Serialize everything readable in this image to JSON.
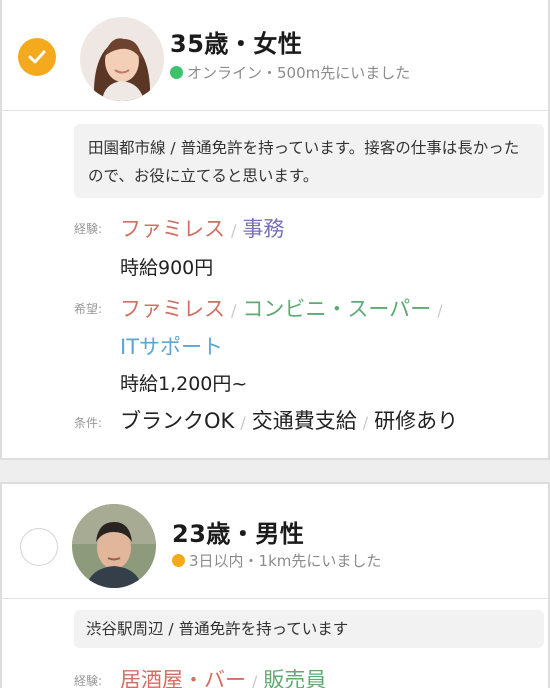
{
  "candidates": [
    {
      "selected": true,
      "name": "35歳・女性",
      "status_color": "#3cc26b",
      "status_text": "オンライン・500m先にいました",
      "bio": "田園都市線 / 普通免許を持っています。接客の仕事は長かったので、お役に立てると思います。",
      "experience": {
        "label": "経験:",
        "items": [
          {
            "text": "ファミレス",
            "color": "red"
          },
          {
            "text": "事務",
            "color": "purple"
          }
        ],
        "wage": "時給900円"
      },
      "desired": {
        "label": "希望:",
        "items": [
          {
            "text": "ファミレス",
            "color": "red"
          },
          {
            "text": "コンビニ・スーパー",
            "color": "green"
          },
          {
            "text": "ITサポート",
            "color": "blue"
          }
        ],
        "wage": "時給1,200円~"
      },
      "conditions": {
        "label": "条件:",
        "items": [
          "ブランクOK",
          "交通費支給",
          "研修あり"
        ]
      }
    },
    {
      "selected": false,
      "name": "23歳・男性",
      "status_color": "#f5a91d",
      "status_text": "3日以内・1km先にいました",
      "bio": "渋谷駅周辺 / 普通免許を持っています",
      "experience": {
        "label": "経験:",
        "items": [
          {
            "text": "居酒屋・バー",
            "color": "red"
          },
          {
            "text": "販売員",
            "color": "green"
          }
        ]
      }
    }
  ],
  "colors": {
    "accent": "#f5a91d",
    "red": "#d36e63",
    "purple": "#7771b8",
    "green": "#5eaa73",
    "blue": "#5ea5d2",
    "online": "#3cc26b",
    "recent": "#f5a91d"
  },
  "icons": {
    "checkmark": "check-icon",
    "avatar": "avatar"
  }
}
